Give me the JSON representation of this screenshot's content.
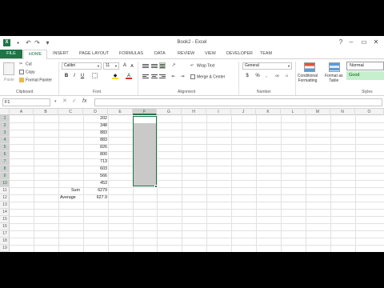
{
  "window": {
    "title": "Book2 - Excel",
    "qat": [
      "save-icon",
      "undo-icon",
      "redo-icon",
      "customize-icon"
    ],
    "controls": {
      "help": "?",
      "minimize": "–",
      "restore": "▭",
      "close": "✕"
    }
  },
  "tabs": [
    "FILE",
    "HOME",
    "INSERT",
    "PAGE LAYOUT",
    "FORMULAS",
    "DATA",
    "REVIEW",
    "VIEW",
    "DEVELOPER",
    "TEAM"
  ],
  "ribbon": {
    "clipboard": {
      "paste": "Paste",
      "cut": "Cut",
      "copy": "Copy",
      "format_painter": "Format Painter",
      "label": "Clipboard"
    },
    "font": {
      "name": "Calibri",
      "size": "11",
      "grow": "A",
      "shrink": "A",
      "bold": "B",
      "italic": "I",
      "underline": "U",
      "label": "Font"
    },
    "alignment": {
      "wrap_text": "Wrap Text",
      "merge_center": "Merge & Center",
      "label": "Alignment"
    },
    "number": {
      "format": "General",
      "currency": "$",
      "percent": "%",
      "comma": ",",
      "label": "Number"
    },
    "styles": {
      "conditional": "Conditional",
      "conditional2": "Formatting",
      "format_as": "Format as",
      "format_as2": "Table",
      "normal": "Normal",
      "good": "Good",
      "label": "Styles"
    }
  },
  "formula_bar": {
    "name_box": "F1",
    "cancel": "✕",
    "enter": "✓",
    "fx": "fx",
    "value": ""
  },
  "columns": [
    "A",
    "B",
    "C",
    "D",
    "E",
    "F",
    "G",
    "H",
    "I",
    "J",
    "K",
    "L",
    "M",
    "N",
    "O"
  ],
  "rows": [
    "1",
    "2",
    "3",
    "4",
    "5",
    "6",
    "7",
    "8",
    "9",
    "10",
    "11",
    "12",
    "13",
    "14",
    "15",
    "16",
    "17",
    "18",
    "19"
  ],
  "cells": {
    "D": [
      "202",
      "348",
      "883",
      "883",
      "826",
      "800",
      "713",
      "603",
      "566",
      "453"
    ],
    "C11": "Sum",
    "D11": "6279",
    "C12": "Average",
    "D12": "627.9"
  },
  "selection": {
    "range": "F1:F10",
    "active": "F1"
  },
  "colors": {
    "accent": "#217346",
    "selection": "#c9c9c9",
    "good_fill": "#c6efce",
    "good_text": "#006100"
  }
}
